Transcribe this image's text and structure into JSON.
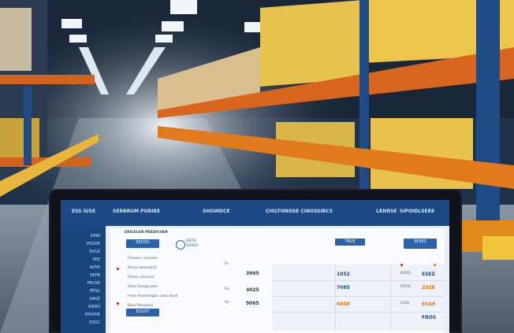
{
  "topbar": {
    "items": [
      "ESS IUSE",
      "SERBRUM PUBIRE",
      "SHOWDCE",
      "CHILTONOSE CINOSSIRCS",
      "LRNRSE",
      "SIPOIDLSERE"
    ]
  },
  "sidebar": {
    "items": [
      "2990",
      "PSGDE",
      "SVGS",
      "XEE",
      "ADYE",
      "SEPR",
      "PRUSE",
      "PESG",
      "SAGE",
      "EIRRS",
      "PIOVPIE",
      "ESGC"
    ]
  },
  "main": {
    "header_text": "ERICELEN PREDICHER",
    "primary_button": "SEDSO",
    "logo_text_1": "ENTIE",
    "logo_text_2": "SOSER",
    "list_items": [
      "Freeoerr anioens",
      "Posse aseeuiant",
      "Onree verrvoer",
      "Oiee Emogovees",
      "Fesie Pruesilages cheo 4(oel",
      "Bare Pesuoecs"
    ],
    "secondary_button": "EDUST",
    "values": [
      "3965",
      "3025",
      "9065"
    ],
    "labels_left": [
      "Fa",
      "Ro",
      "Ra"
    ],
    "panel_button_left": "TRUE",
    "panel_button_right": "SESES",
    "panel_values": [
      "1052",
      "7085",
      "6008"
    ],
    "panel_codes": [
      "ESEEL",
      "EOOS",
      "ESSE"
    ],
    "panel_right_values": [
      "ESEZ",
      "ZSSE",
      "ESGE",
      "FROS"
    ]
  },
  "colors": {
    "accent_blue": "#1d4a86",
    "button_blue": "#2c62a8",
    "warning_red": "#c9342b",
    "orange": "#e07a1c"
  }
}
